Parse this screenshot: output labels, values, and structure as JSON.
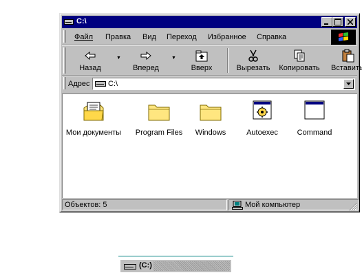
{
  "window": {
    "title": "C:\\"
  },
  "menu": {
    "items": [
      {
        "label": "Файл"
      },
      {
        "label": "Правка"
      },
      {
        "label": "Вид"
      },
      {
        "label": "Переход"
      },
      {
        "label": "Избранное"
      },
      {
        "label": "Справка"
      }
    ]
  },
  "toolbar": {
    "back_label": "Назад",
    "forward_label": "Вперед",
    "up_label": "Вверх",
    "cut_label": "Вырезать",
    "copy_label": "Копировать",
    "paste_label": "Вставить"
  },
  "address": {
    "label": "Адрес",
    "value": "C:\\"
  },
  "items": [
    {
      "label": "Мои документы",
      "icon": "my-documents-folder-icon"
    },
    {
      "label": "Program Files",
      "icon": "folder-icon"
    },
    {
      "label": "Windows",
      "icon": "folder-icon"
    },
    {
      "label": "Autoexec",
      "icon": "batch-file-icon"
    },
    {
      "label": "Command",
      "icon": "application-window-icon"
    }
  ],
  "status": {
    "objects": "Объектов: 5",
    "location": "Мой компьютер"
  },
  "taskbar_item": {
    "label": "(C:)"
  },
  "colors": {
    "titlebar": "#000080",
    "face": "#c0c0c0",
    "folder": "#ffe680"
  }
}
